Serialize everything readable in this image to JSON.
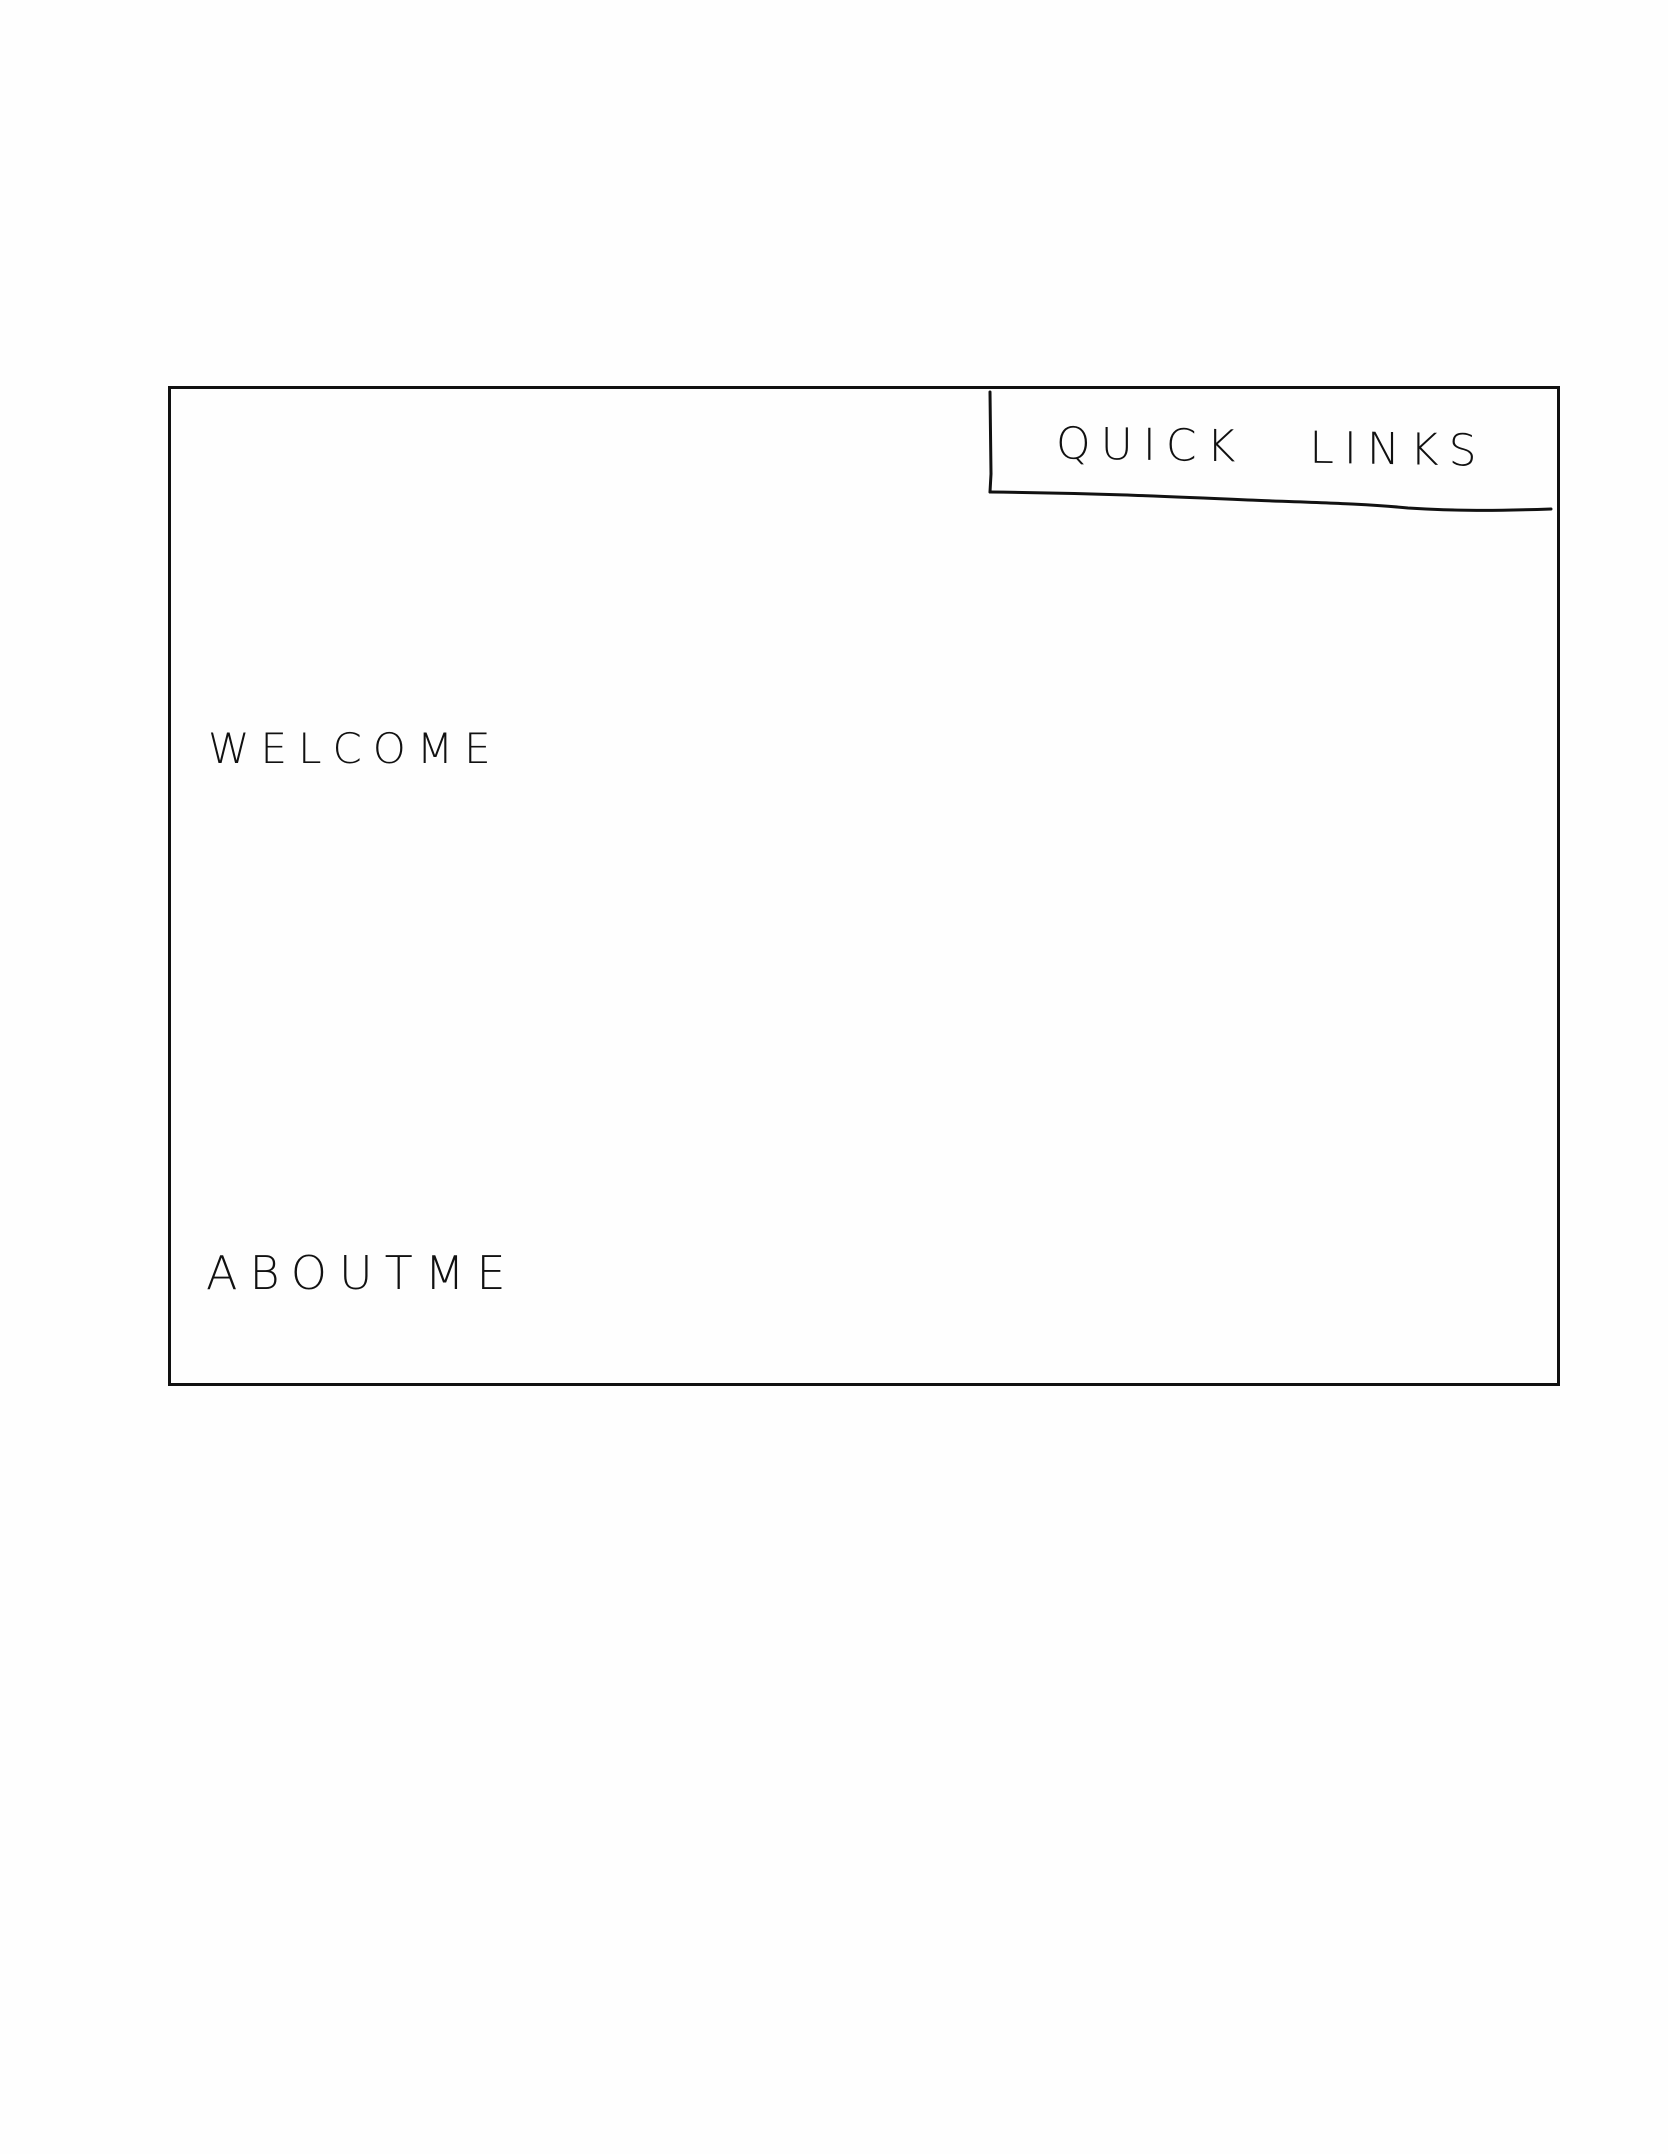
{
  "header": {
    "quick_links_label": "QUICK LINKS"
  },
  "main": {
    "welcome_label": "WELCOME",
    "about_label": "ABOUTME"
  },
  "colors": {
    "stroke": "#111111",
    "background": "#fefefe"
  }
}
